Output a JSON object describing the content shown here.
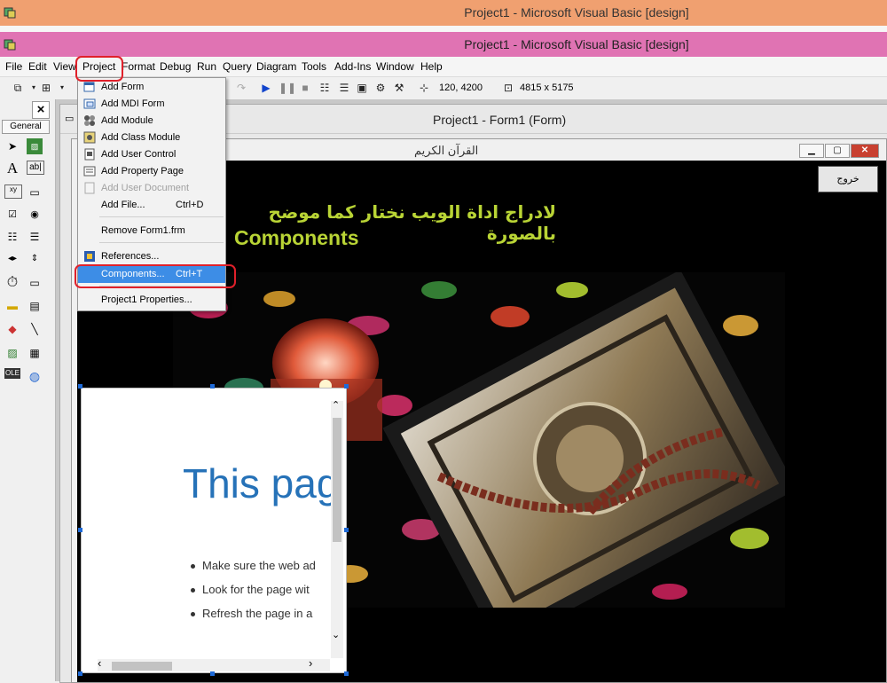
{
  "outer_title": "Project1 - Microsoft Visual Basic [design]",
  "inner_title": "Project1 - Microsoft Visual Basic [design]",
  "menubar": [
    "File",
    "Edit",
    "View",
    "Project",
    "Format",
    "Debug",
    "Run",
    "Query",
    "Diagram",
    "Tools",
    "Add-Ins",
    "Window",
    "Help"
  ],
  "toolbar": {
    "position": "120, 4200",
    "size": "4815 x 5175"
  },
  "toolbox": {
    "tab": "General"
  },
  "project_window": {
    "title": "Project1 - Form1 (Form)"
  },
  "form": {
    "caption": "القرآن الكريم",
    "exit_button": "خروج",
    "arabic_line": "لادراج اداة الويب نختار كما موضح بالصورة",
    "components_label": "Components"
  },
  "web_control": {
    "heading": "This pag",
    "bullets": [
      "Make sure the web ad",
      "Look for the page wit",
      "Refresh the page in a"
    ]
  },
  "project_menu": {
    "items": [
      {
        "label": "Add Form",
        "shortcut": ""
      },
      {
        "label": "Add MDI Form",
        "shortcut": ""
      },
      {
        "label": "Add Module",
        "shortcut": ""
      },
      {
        "label": "Add Class Module",
        "shortcut": ""
      },
      {
        "label": "Add User Control",
        "shortcut": ""
      },
      {
        "label": "Add Property Page",
        "shortcut": ""
      },
      {
        "label": "Add User Document",
        "shortcut": ""
      },
      {
        "label": "Add File...",
        "shortcut": "Ctrl+D"
      },
      {
        "label": "Remove Form1.frm",
        "shortcut": ""
      },
      {
        "label": "References...",
        "shortcut": ""
      },
      {
        "label": "Components...",
        "shortcut": "Ctrl+T"
      },
      {
        "label": "Project1 Properties...",
        "shortcut": ""
      }
    ]
  },
  "colors": {
    "highlight": "#3d8de6",
    "annotation": "#e0202a",
    "caption_text": "#b9d435",
    "title_orange": "#f0a070",
    "title_pink": "#e073b3"
  },
  "icons": [
    "app-icon",
    "pointer-icon",
    "label-icon",
    "textbox-icon",
    "frame-icon",
    "button-icon",
    "checkbox-icon",
    "radio-icon",
    "combo-icon",
    "list-icon",
    "hscroll-icon",
    "vscroll-icon",
    "timer-icon",
    "drive-icon",
    "folder-icon",
    "file-icon",
    "shape-icon",
    "line-icon",
    "image-icon",
    "data-icon",
    "ole-icon",
    "globe-icon"
  ]
}
